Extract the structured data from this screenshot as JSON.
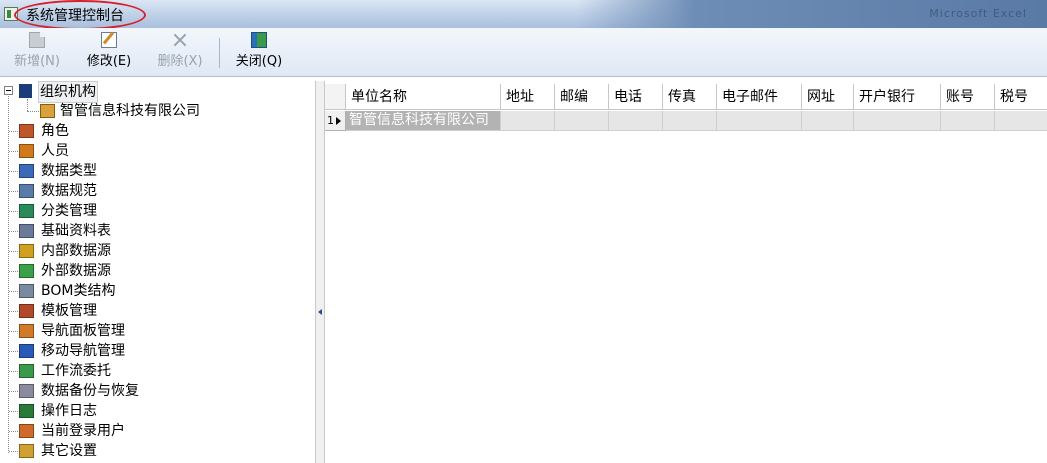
{
  "window": {
    "title": "系统管理控制台",
    "right_text": "Microsoft Excel"
  },
  "toolbar": {
    "new_label": "新增(N)",
    "edit_label": "修改(E)",
    "delete_label": "删除(X)",
    "close_label": "关闭(Q)"
  },
  "tree": {
    "root": "组织机构",
    "company": "智管信息科技有限公司",
    "items": [
      "角色",
      "人员",
      "数据类型",
      "数据规范",
      "分类管理",
      "基础资料表",
      "内部数据源",
      "外部数据源",
      "BOM类结构",
      "模板管理",
      "导航面板管理",
      "移动导航管理",
      "工作流委托",
      "数据备份与恢复",
      "操作日志",
      "当前登录用户",
      "其它设置"
    ]
  },
  "grid": {
    "columns": [
      "单位名称",
      "地址",
      "邮编",
      "电话",
      "传真",
      "电子邮件",
      "网址",
      "开户银行",
      "账号",
      "税号"
    ],
    "rows": [
      {
        "index": "1",
        "cells": [
          "智管信息科技有限公司",
          "",
          "",
          "",
          "",
          "",
          "",
          "",
          "",
          ""
        ]
      }
    ]
  },
  "colors": {
    "title_ring": "#d8202a",
    "selected_row": "#b3b3b3"
  }
}
